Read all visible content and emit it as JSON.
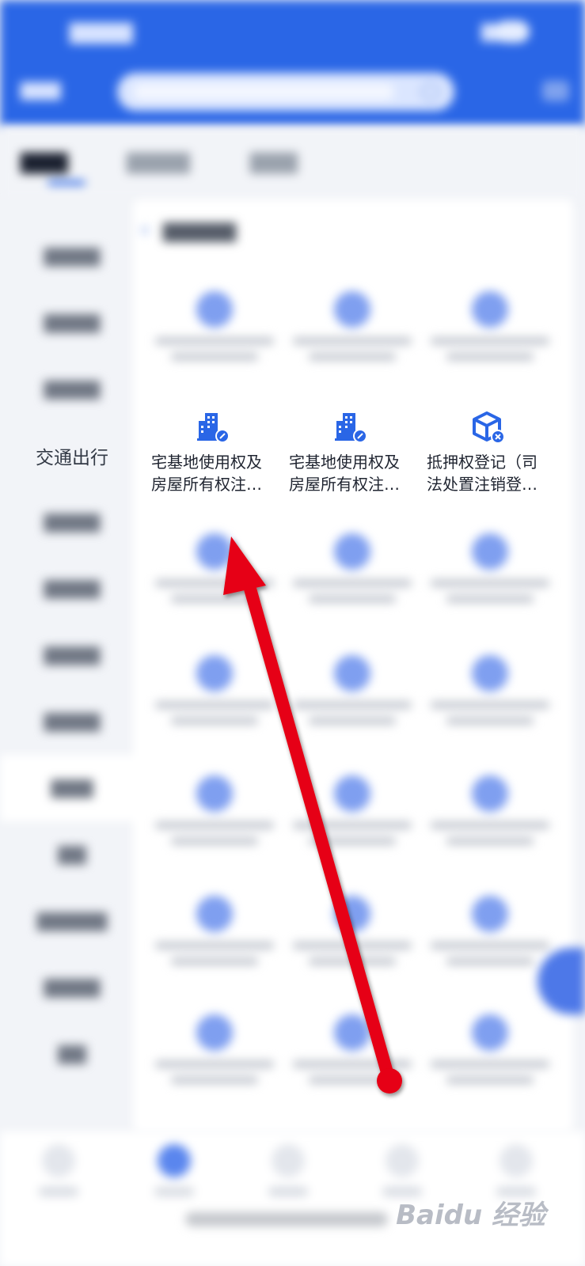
{
  "sidebar": {
    "selected_category": "交通出行"
  },
  "focus_row": {
    "items": [
      {
        "label": "宅基地使用权及\n房屋所有权注…",
        "icon": "building-edit-icon"
      },
      {
        "label": "宅基地使用权及\n房屋所有权注…",
        "icon": "building-edit-icon"
      },
      {
        "label": "抵押权登记（司\n法处置注销登…",
        "icon": "cube-close-icon"
      }
    ]
  },
  "colors": {
    "header": "#2a66e6",
    "icon": "#2a66e6",
    "arrow": "#e60012"
  }
}
